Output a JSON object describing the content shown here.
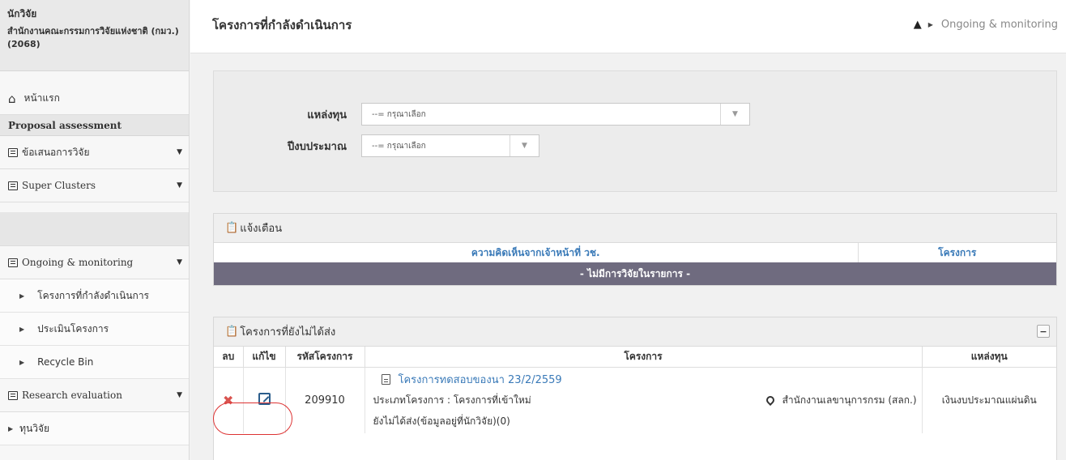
{
  "sidebar": {
    "user_role": "นักวิจัย",
    "user_org": "สำนักงานคณะกรรมการวิจัยแห่งชาติ (กมว.)(2068)",
    "home_label": "หน้าแรก",
    "section_proposal": "Proposal assessment",
    "item_proposals": "ข้อเสนอการวิจัย",
    "item_super_clusters": "Super Clusters",
    "item_ongoing": "Ongoing & monitoring",
    "sub_ongoing_projects": "โครงการที่กำลังดำเนินการ",
    "sub_evaluate": "ประเมินโครงการ",
    "sub_recycle": "Recycle Bin",
    "item_research_eval": "Research evaluation",
    "sub_fund": "ทุนวิจัย"
  },
  "header": {
    "title": "โครงการที่กำลังดำเนินการ",
    "breadcrumb": "Ongoing & monitoring"
  },
  "filter": {
    "fund_label": "แหล่งทุน",
    "fund_placeholder": "--= กรุณาเลือก",
    "year_label": "ปีงบประมาณ",
    "year_placeholder": "--= กรุณาเลือก"
  },
  "alerts": {
    "title": "แจ้งเตือน",
    "col_comment": "ความคิดเห็นจากเจ้าหน้าที่ วช.",
    "col_project": "โครงการ",
    "empty_text": "- ไม่มีการวิจัยในรายการ -"
  },
  "unsent": {
    "title": "โครงการที่ยังไม่ได้ส่ง",
    "collapse": "−",
    "columns": [
      "ลบ",
      "แก้ไข",
      "รหัสโครงการ",
      "โครงการ",
      "แหล่งทุน"
    ],
    "rows": [
      {
        "code": "209910",
        "project_title": "โครงการทดสอบของนา 23/2/2559",
        "project_type": "ประเภทโครงการ : โครงการที่เข้าใหม่",
        "agency": "สำนักงานเลขานุการกรม (สลก.)",
        "status": "ยังไม่ได้ส่ง(ข้อมูลอยู่ที่นักวิจัย)(0)",
        "fund": "เงินงบประมาณแผ่นดิน"
      }
    ]
  }
}
